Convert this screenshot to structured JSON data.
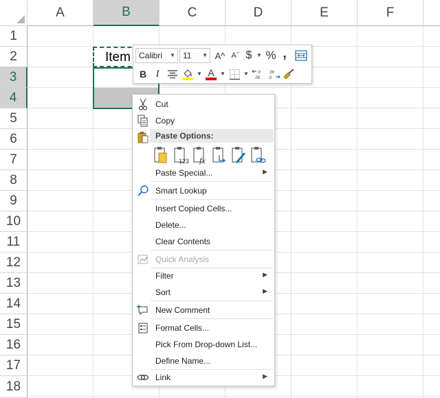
{
  "grid": {
    "columns": [
      "A",
      "B",
      "C",
      "D",
      "E",
      "F"
    ],
    "selected_column": "B",
    "rows": [
      "1",
      "2",
      "3",
      "4",
      "5",
      "6",
      "7",
      "8",
      "9",
      "10",
      "11",
      "12",
      "13",
      "14",
      "15",
      "16",
      "17",
      "18"
    ],
    "selected_rows": [
      "3",
      "4"
    ],
    "cells": {
      "B2": "Item"
    }
  },
  "mini_toolbar": {
    "font_name": "Calibri",
    "font_size": "11",
    "currency_symbol": "$",
    "percent_symbol": "%",
    "comma_symbol": ",",
    "bold": "B",
    "italic": "I",
    "font_color_letter": "A",
    "increase_font": "A^",
    "decrease_font": "Aˇ",
    "font_color": "#e00000",
    "fill_color": "#ffff00"
  },
  "context_menu": {
    "cut": "Cut",
    "copy": "Copy",
    "paste_options": "Paste Options:",
    "paste_special": "Paste Special...",
    "smart_lookup": "Smart Lookup",
    "insert_copied_cells": "Insert Copied Cells...",
    "delete": "Delete...",
    "clear_contents": "Clear Contents",
    "quick_analysis": "Quick Analysis",
    "filter": "Filter",
    "sort": "Sort",
    "new_comment": "New Comment",
    "format_cells": "Format Cells...",
    "pick_from_dropdown": "Pick From Drop-down List...",
    "define_name": "Define Name...",
    "link": "Link"
  },
  "colors": {
    "selection_green": "#217346",
    "icon_blue": "#1f6fb4",
    "icon_gold": "#d4a017"
  }
}
